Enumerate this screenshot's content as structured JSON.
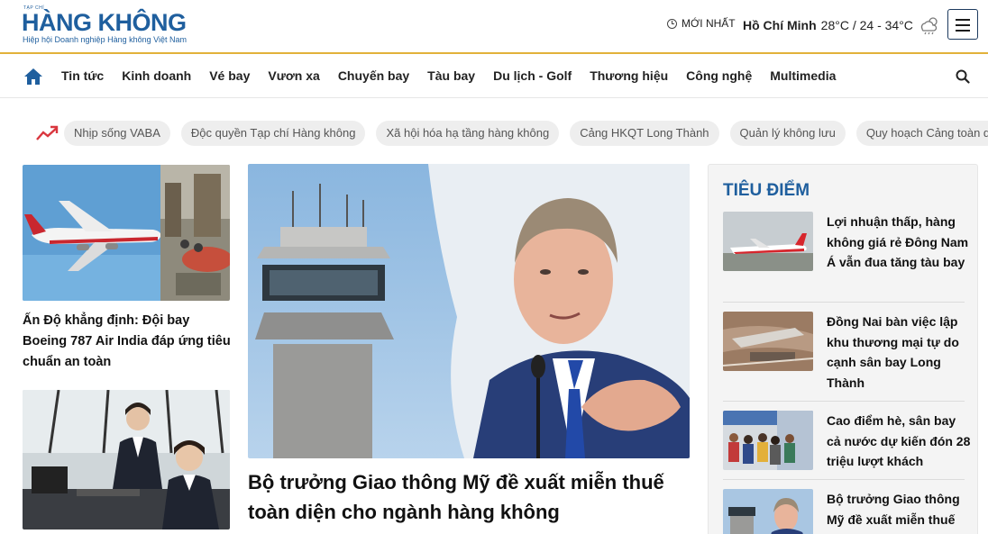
{
  "header": {
    "logo_small": "TẠP CHÍ",
    "logo_main": "HÀNG KHÔNG",
    "logo_sub": "Hiệp hội Doanh nghiệp Hàng không Việt Nam",
    "latest_label": "MỚI NHẤT",
    "weather": {
      "city": "Hồ Chí Minh",
      "temp": "28°C / 24 - 34°C"
    }
  },
  "nav": {
    "items": [
      "Tin tức",
      "Kinh doanh",
      "Vé bay",
      "Vươn xa",
      "Chuyến bay",
      "Tàu bay",
      "Du lịch - Golf",
      "Thương hiệu",
      "Công nghệ",
      "Multimedia"
    ]
  },
  "trending": {
    "tags": [
      "Nhịp sống VABA",
      "Độc quyền Tạp chí Hàng không",
      "Xã hội hóa hạ tầng hàng không",
      "Cảng HKQT Long Thành",
      "Quản lý không lưu",
      "Quy hoạch Cảng toàn q"
    ]
  },
  "left": {
    "story1_title": "Ấn Độ khẳng định: Đội bay Boeing 787 Air India đáp ứng tiêu chuẩn an toàn"
  },
  "featured": {
    "title": "Bộ trưởng Giao thông Mỹ đề xuất miễn thuế toàn diện cho ngành hàng không"
  },
  "focus": {
    "heading": "TIÊU ĐIỂM",
    "items": [
      {
        "title": "Lợi nhuận thấp, hàng không giá rẻ Đông Nam Á vẫn đua tăng tàu bay"
      },
      {
        "title": "Đồng Nai bàn việc lập khu thương mại tự do cạnh sân bay Long Thành"
      },
      {
        "title": "Cao điểm hè, sân bay cả nước dự kiến đón 28 triệu lượt khách"
      },
      {
        "title": "Bộ trưởng Giao thông Mỹ đề xuất miễn thuế"
      }
    ]
  },
  "colors": {
    "brand_blue": "#1f5f9e",
    "accent_gold": "#e2b23a",
    "trend_red": "#d9363e"
  }
}
